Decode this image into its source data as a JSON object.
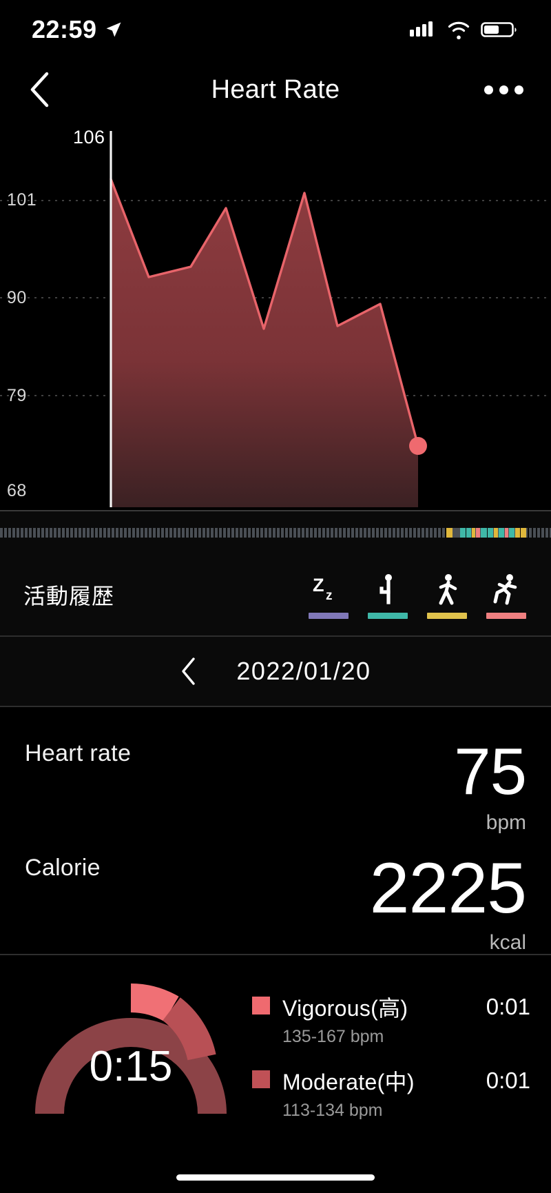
{
  "status_bar": {
    "time": "22:59",
    "location_icon": "location-arrow-icon",
    "signal_icon": "cellular-signal-icon",
    "wifi_icon": "wifi-icon",
    "battery_icon": "battery-icon"
  },
  "nav": {
    "back_icon": "chevron-left-icon",
    "title": "Heart Rate",
    "more_icon": "ellipsis-icon"
  },
  "chart_data": {
    "type": "area",
    "title": "Heart Rate",
    "xlabel": "",
    "ylabel": "bpm",
    "ylim": [
      68,
      106
    ],
    "grid": true,
    "tick_labels": [
      "106",
      "101",
      "90",
      "79",
      "68"
    ],
    "tick_values": [
      106,
      101,
      90,
      79,
      68
    ],
    "line_color": "#e8646a",
    "fill_color": "#7a3236",
    "marker": {
      "color": "#ef6a6f",
      "value": 75,
      "label": ""
    },
    "series": [
      {
        "name": "Heart rate",
        "x": [
          0,
          1,
          2,
          3,
          4,
          5,
          6,
          7,
          8,
          9,
          10
        ],
        "values": [
          104,
          91,
          93,
          100,
          88,
          101,
          88,
          89.5,
          75,
          75,
          75
        ]
      }
    ]
  },
  "timeline": {
    "name": "activity-timeline",
    "base_color": "#4a4f55",
    "segments": [
      {
        "color": "#e0b83c",
        "start_pct": 81.0,
        "width_pct": 1.1
      },
      {
        "color": "#4a4f55",
        "start_pct": 82.1,
        "width_pct": 1.4
      },
      {
        "color": "#3fb8a8",
        "start_pct": 83.5,
        "width_pct": 1.0
      },
      {
        "color": "#3fb8a8",
        "start_pct": 84.6,
        "width_pct": 0.9
      },
      {
        "color": "#e0b83c",
        "start_pct": 85.6,
        "width_pct": 0.7
      },
      {
        "color": "#ef7f7f",
        "start_pct": 86.4,
        "width_pct": 0.7
      },
      {
        "color": "#3fb8a8",
        "start_pct": 87.2,
        "width_pct": 1.2
      },
      {
        "color": "#3fb8a8",
        "start_pct": 88.5,
        "width_pct": 1.0
      },
      {
        "color": "#e0b83c",
        "start_pct": 89.6,
        "width_pct": 0.8
      },
      {
        "color": "#3fb8a8",
        "start_pct": 90.5,
        "width_pct": 1.0
      },
      {
        "color": "#ef7f7f",
        "start_pct": 91.6,
        "width_pct": 0.7
      },
      {
        "color": "#3fb8a8",
        "start_pct": 92.4,
        "width_pct": 1.0
      },
      {
        "color": "#e0b83c",
        "start_pct": 93.5,
        "width_pct": 0.9
      },
      {
        "color": "#e0b83c",
        "start_pct": 94.5,
        "width_pct": 1.0
      }
    ]
  },
  "activity": {
    "title": "活動履歴",
    "items": [
      {
        "icon": "sleep-zz-icon",
        "color": "#8078b8",
        "name": "sleep"
      },
      {
        "icon": "sitting-person-icon",
        "color": "#3fb8a8",
        "name": "sedentary"
      },
      {
        "icon": "walking-person-icon",
        "color": "#e0c24c",
        "name": "walking"
      },
      {
        "icon": "running-person-icon",
        "color": "#ef7f80",
        "name": "running"
      }
    ]
  },
  "date_nav": {
    "prev_icon": "chevron-left-icon",
    "date": "2022/01/20"
  },
  "stats": [
    {
      "label": "Heart rate",
      "value": "75",
      "unit": "bpm",
      "key": "heart-rate"
    },
    {
      "label": "Calorie",
      "value": "2225",
      "unit": "kcal",
      "key": "calorie"
    }
  ],
  "zones": {
    "gauge": {
      "total": "0:15",
      "track_color": "#8c4347",
      "arcs": [
        {
          "color": "#8c4347",
          "name": "base"
        },
        {
          "color": "#f07075",
          "name": "vigorous"
        },
        {
          "color": "#b85055",
          "name": "moderate"
        }
      ]
    },
    "legend": [
      {
        "color": "#ef6a6f",
        "name": "Vigorous(高)",
        "range": "135-167 bpm",
        "time": "0:01"
      },
      {
        "color": "#c05156",
        "name": "Moderate(中)",
        "range": "113-134 bpm",
        "time": "0:01"
      }
    ]
  }
}
